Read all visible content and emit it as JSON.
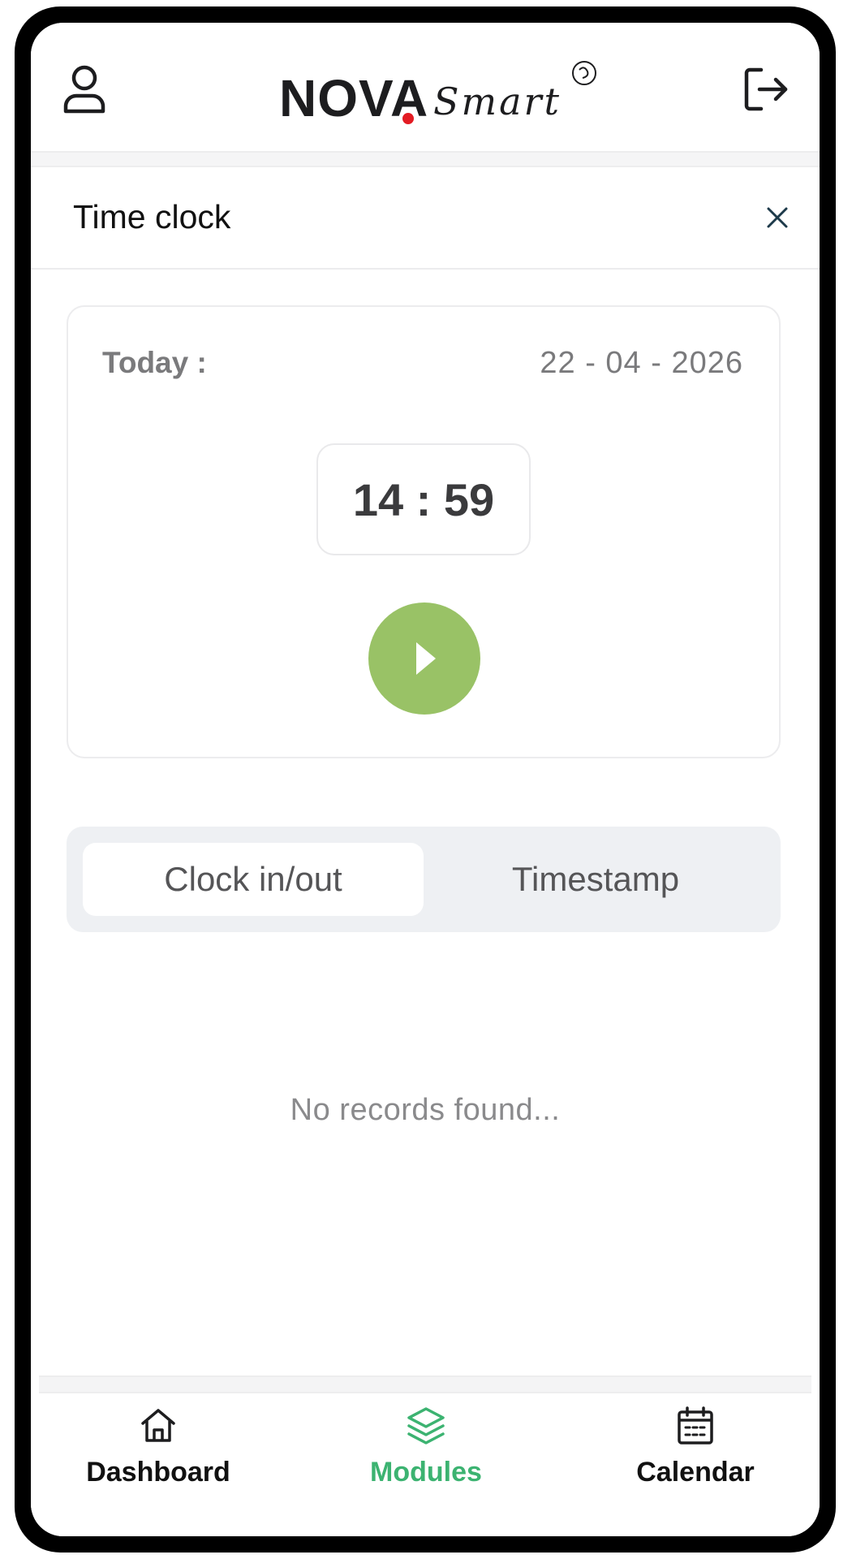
{
  "header": {
    "logo_brand": "NOVA",
    "logo_sub": "Smart",
    "profile_icon": "user-icon",
    "logout_icon": "logout-icon"
  },
  "page": {
    "title": "Time clock",
    "close_icon": "close-icon"
  },
  "time_card": {
    "today_label": "Today :",
    "date": "22 - 04 - 2026",
    "time": "14 : 59",
    "play_icon": "play-icon",
    "play_color": "#99c266"
  },
  "tabs": [
    {
      "label": "Clock in/out",
      "active": true
    },
    {
      "label": "Timestamp",
      "active": false
    }
  ],
  "records": {
    "empty_message": "No records found..."
  },
  "bottom_nav": {
    "items": [
      {
        "label": "Dashboard",
        "icon": "home-icon",
        "active": false
      },
      {
        "label": "Modules",
        "icon": "layers-icon",
        "active": true
      },
      {
        "label": "Calendar",
        "icon": "calendar-icon",
        "active": false
      }
    ],
    "active_color": "#3cb371"
  }
}
